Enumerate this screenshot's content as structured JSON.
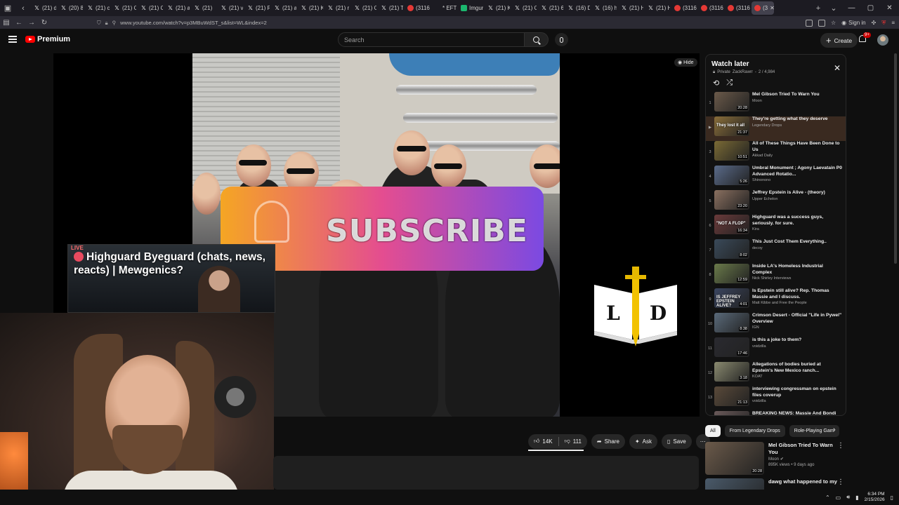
{
  "browser": {
    "tabs": [
      {
        "label": "(21) d",
        "icon": "x-icon"
      },
      {
        "label": "(20) 8",
        "icon": "x-icon"
      },
      {
        "label": "(21) c",
        "icon": "x-icon"
      },
      {
        "label": "(21) C",
        "icon": "x-icon"
      },
      {
        "label": "(21) C",
        "icon": "x-icon"
      },
      {
        "label": "(21) a",
        "icon": "x-icon"
      },
      {
        "label": "(21) ",
        "icon": "x-icon"
      },
      {
        "label": "(21) v",
        "icon": "x-icon"
      },
      {
        "label": "(21) R",
        "icon": "x-icon"
      },
      {
        "label": "(21) a",
        "icon": "x-icon"
      },
      {
        "label": "(21) K",
        "icon": "x-icon"
      },
      {
        "label": "(21) r",
        "icon": "x-icon"
      },
      {
        "label": "(21) C",
        "icon": "x-icon"
      },
      {
        "label": "(21) T",
        "icon": "x-icon"
      },
      {
        "label": "(3116",
        "icon": "youtube-icon"
      },
      {
        "label": "* EFT",
        "icon": "generic-icon"
      },
      {
        "label": "Imgur",
        "icon": "imgur-icon"
      },
      {
        "label": "(21) K",
        "icon": "x-icon"
      },
      {
        "label": "(21) C",
        "icon": "x-icon"
      },
      {
        "label": "(21) 6",
        "icon": "x-icon"
      },
      {
        "label": "(16) D",
        "icon": "x-icon"
      },
      {
        "label": "(16) h",
        "icon": "x-icon"
      },
      {
        "label": "(21) H",
        "icon": "x-icon"
      },
      {
        "label": "(21) H",
        "icon": "x-icon"
      },
      {
        "label": "(3116",
        "icon": "youtube-icon"
      },
      {
        "label": "(3116",
        "icon": "youtube-icon"
      },
      {
        "label": "(3116",
        "icon": "youtube-icon"
      },
      {
        "label": "(3",
        "icon": "youtube-icon",
        "active": true
      }
    ],
    "url": "www.youtube.com/watch?v=p3MBuWdST_s&list=WL&index=2",
    "sign_in": "Sign in"
  },
  "masthead": {
    "logo_text": "Premium",
    "search_placeholder": "Search",
    "create_label": "Create",
    "notifications_badge": "9+"
  },
  "player": {
    "overlay_text": "SUBSCRIBE",
    "hide_label": "Hide"
  },
  "stream_overlay": {
    "live_label": "LIVE",
    "title": "Highguard Byeguard (chats, news, reacts) | Mewgenics?"
  },
  "actions": {
    "likes": "14K",
    "dislikes": "111",
    "share": "Share",
    "ask": "Ask",
    "save": "Save"
  },
  "playlist": {
    "title": "Watch later",
    "privacy": "Private",
    "owner": "ZackRawrr",
    "position": "2 / 4,984",
    "items": [
      {
        "index": "1",
        "title": "Mel Gibson Tried To Warn You",
        "channel": "Moon",
        "duration": "20:28",
        "thumb": "#6b5a4a"
      },
      {
        "index": "▶",
        "title": "They're getting what they deserve",
        "channel": "Legendary Drops",
        "duration": "21:37",
        "thumb": "#8a6e3a",
        "thumb_text": "They lost it all",
        "current": true
      },
      {
        "index": "3",
        "title": "All of These Things Have Been Done to Us",
        "channel": "Akkad Daily",
        "duration": "10:51",
        "thumb": "#7a6a35"
      },
      {
        "index": "4",
        "title": "Umbral Monument ; Agony Laevatain P0 Advanced Rotatio...",
        "channel": "Shinonono",
        "duration": "5:26",
        "thumb": "#5a6b8a"
      },
      {
        "index": "5",
        "title": "Jeffrey Epstein is Alive - (theory)",
        "channel": "Upper Echelon",
        "duration": "23:20",
        "thumb": "#8a7060"
      },
      {
        "index": "6",
        "title": "Highguard was a success guys, seriously. for sure.",
        "channel": "Kira",
        "duration": "16:34",
        "thumb": "#6a3a3a",
        "thumb_text": "\"NOT A FLOP\""
      },
      {
        "index": "7",
        "title": "This Just Cost Them Everything..",
        "channel": "decoy",
        "duration": "8:02",
        "thumb": "#3a4a5a"
      },
      {
        "index": "8",
        "title": "Inside LA's Homeless Industrial Complex",
        "channel": "Nick Shirley Interviews",
        "duration": "12:59",
        "thumb": "#6a7a4a"
      },
      {
        "index": "9",
        "title": "Is Epstein still alive? Rep. Thomas Massie and I discuss.",
        "channel": "Matt Kibbe and Free the People",
        "duration": "4:01",
        "thumb": "#3a4560",
        "thumb_text": "IS JEFFREY EPSTEIN ALIVE?"
      },
      {
        "index": "10",
        "title": "Crimson Desert - Official \"Life in Pywel\" Overview",
        "channel": "IGN",
        "duration": "8:38",
        "thumb": "#5a6a7a"
      },
      {
        "index": "11",
        "title": "is this a joke to them?",
        "channel": "voidzilla",
        "duration": "17:46",
        "thumb": "#2a2a30"
      },
      {
        "index": "12",
        "title": "Allegations of bodies buried at Epstein's New Mexico ranch...",
        "channel": "KOAT",
        "duration": "3:18",
        "thumb": "#8a8a70"
      },
      {
        "index": "13",
        "title": "interviewing congressman on epstein files coverup",
        "channel": "voidzilla",
        "duration": "21:13",
        "thumb": "#5a4a3a"
      },
      {
        "index": "14",
        "title": "BREAKING NEWS: Massie And Bondi Have Shocking Fight As H...",
        "channel": "",
        "duration": "",
        "thumb": "#6a5a5a"
      }
    ]
  },
  "chips": [
    "All",
    "From Legendary Drops",
    "Role-Playing Gam"
  ],
  "recommendations": [
    {
      "title": "Mel Gibson Tried To Warn You",
      "channel": "Moon",
      "meta": "895K views • 9 days ago",
      "duration": "20:28",
      "thumb": "#6b5a4a"
    },
    {
      "title": "dawg what happened to my",
      "channel": "",
      "meta": "",
      "duration": "",
      "thumb": "#4a5a6a"
    }
  ],
  "taskbar": {
    "time": "6:34 PM",
    "date": "2/15/2026"
  },
  "colors": {
    "background": "#0f0f0f",
    "youtube_red": "#ff0000",
    "current_item_bg": "#3a2a20"
  }
}
